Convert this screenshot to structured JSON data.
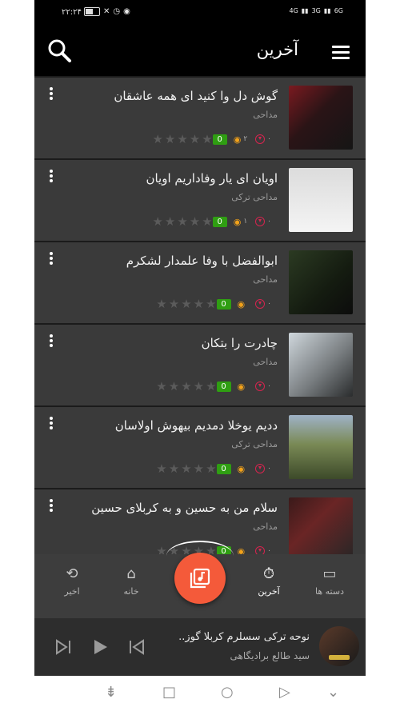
{
  "status_bar": {
    "time": "۲۲:۲۴",
    "network_1": "4G",
    "network_2": "3G",
    "network_3": "6G"
  },
  "app_bar": {
    "title": "آخرین",
    "icons": {
      "menu": "hamburger-icon",
      "search": "search-icon"
    }
  },
  "list": {
    "items": [
      {
        "title": "گوش دل وا کنید ای همه عاشقان",
        "subtitle": "مداحی",
        "score": "0",
        "views": "۲",
        "downloads": "۰"
      },
      {
        "title": "اویان ای یار وفاداریم اویان",
        "subtitle": "مداحی ترکی",
        "score": "0",
        "views": "۱",
        "downloads": "۰"
      },
      {
        "title": "ابوالفضل با وفا علمدار لشکرم",
        "subtitle": "مداحی",
        "score": "0",
        "views": "",
        "downloads": "۰"
      },
      {
        "title": "چادرت را بتکان",
        "subtitle": "مداحی",
        "score": "0",
        "views": "",
        "downloads": "۰"
      },
      {
        "title": "ددیم یوخلا دمدیم بیهوش اولاسان",
        "subtitle": "مداحی ترکی",
        "score": "0",
        "views": "",
        "downloads": "۰"
      },
      {
        "title": "سلام من به حسین و به کربلای حسین",
        "subtitle": "مداحی",
        "score": "0",
        "views": "",
        "downloads": "۰"
      }
    ]
  },
  "bottom_nav": {
    "tabs": [
      {
        "label": "دسته ها",
        "icon": "folder-icon"
      },
      {
        "label": "آخرین",
        "icon": "alert-clock-icon",
        "active": true
      },
      {
        "label": "خانه",
        "icon": "home-icon"
      },
      {
        "label": "اخیر",
        "icon": "history-icon"
      }
    ],
    "fab_icon": "music-library-icon"
  },
  "player": {
    "title": "نوحه ترکی سسلرم کربلا گوز..",
    "artist": "سید طالع برادیگاهی"
  },
  "colors": {
    "accent": "#f45a3a",
    "score_green": "#2f9e12",
    "eye": "#f2a21a",
    "download": "#d6244f"
  }
}
